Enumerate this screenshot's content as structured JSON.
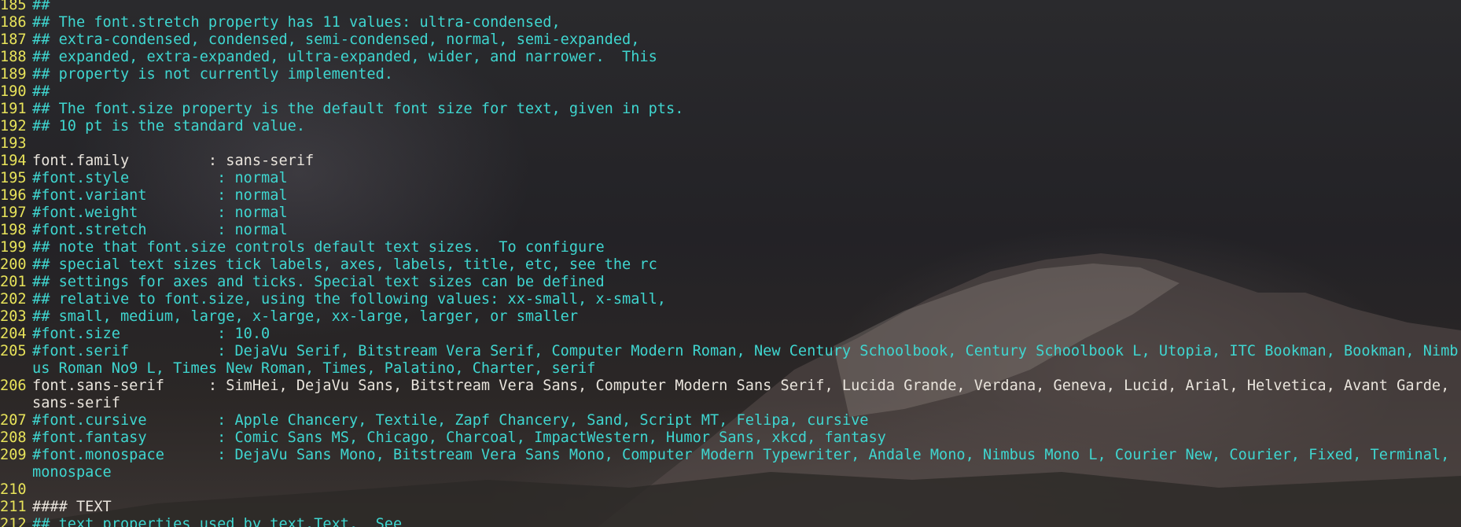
{
  "editor": {
    "lines": [
      {
        "n": "185",
        "text": "##",
        "kind": "comment"
      },
      {
        "n": "186",
        "text": "## The font.stretch property has 11 values: ultra-condensed,",
        "kind": "comment"
      },
      {
        "n": "187",
        "text": "## extra-condensed, condensed, semi-condensed, normal, semi-expanded,",
        "kind": "comment"
      },
      {
        "n": "188",
        "text": "## expanded, extra-expanded, ultra-expanded, wider, and narrower.  This",
        "kind": "comment"
      },
      {
        "n": "189",
        "text": "## property is not currently implemented.",
        "kind": "comment"
      },
      {
        "n": "190",
        "text": "##",
        "kind": "comment"
      },
      {
        "n": "191",
        "text": "## The font.size property is the default font size for text, given in pts.",
        "kind": "comment"
      },
      {
        "n": "192",
        "text": "## 10 pt is the standard value.",
        "kind": "comment"
      },
      {
        "n": "193",
        "text": "",
        "kind": "plain"
      },
      {
        "n": "194",
        "text": "font.family         : sans-serif",
        "kind": "plain"
      },
      {
        "n": "195",
        "text": "#font.style          : normal",
        "kind": "comment"
      },
      {
        "n": "196",
        "text": "#font.variant        : normal",
        "kind": "comment"
      },
      {
        "n": "197",
        "text": "#font.weight         : normal",
        "kind": "comment"
      },
      {
        "n": "198",
        "text": "#font.stretch        : normal",
        "kind": "comment"
      },
      {
        "n": "199",
        "text": "## note that font.size controls default text sizes.  To configure",
        "kind": "comment"
      },
      {
        "n": "200",
        "text": "## special text sizes tick labels, axes, labels, title, etc, see the rc",
        "kind": "comment"
      },
      {
        "n": "201",
        "text": "## settings for axes and ticks. Special text sizes can be defined",
        "kind": "comment"
      },
      {
        "n": "202",
        "text": "## relative to font.size, using the following values: xx-small, x-small,",
        "kind": "comment"
      },
      {
        "n": "203",
        "text": "## small, medium, large, x-large, xx-large, larger, or smaller",
        "kind": "comment"
      },
      {
        "n": "204",
        "text": "#font.size           : 10.0",
        "kind": "comment"
      },
      {
        "n": "205",
        "text": "#font.serif          : DejaVu Serif, Bitstream Vera Serif, Computer Modern Roman, New Century Schoolbook, Century Schoolbook L, Utopia, ITC Bookman, Bookman, Nimbus Roman No9 L, Times New Roman, Times, Palatino, Charter, serif",
        "kind": "comment",
        "wrap": true
      },
      {
        "n": "206",
        "text": "font.sans-serif     : SimHei, DejaVu Sans, Bitstream Vera Sans, Computer Modern Sans Serif, Lucida Grande, Verdana, Geneva, Lucid, Arial, Helvetica, Avant Garde, sans-serif",
        "kind": "plain",
        "wrap": true
      },
      {
        "n": "207",
        "text": "#font.cursive        : Apple Chancery, Textile, Zapf Chancery, Sand, Script MT, Felipa, cursive",
        "kind": "comment"
      },
      {
        "n": "208",
        "text": "#font.fantasy        : Comic Sans MS, Chicago, Charcoal, ImpactWestern, Humor Sans, xkcd, fantasy",
        "kind": "comment"
      },
      {
        "n": "209",
        "text": "#font.monospace      : DejaVu Sans Mono, Bitstream Vera Sans Mono, Computer Modern Typewriter, Andale Mono, Nimbus Mono L, Courier New, Courier, Fixed, Terminal, monospace",
        "kind": "comment",
        "wrap": true
      },
      {
        "n": "210",
        "text": "",
        "kind": "plain"
      },
      {
        "n": "211",
        "text": "#### TEXT",
        "kind": "plain"
      },
      {
        "n": "212",
        "text": "## text properties used by text.Text.  See",
        "kind": "comment"
      }
    ]
  }
}
